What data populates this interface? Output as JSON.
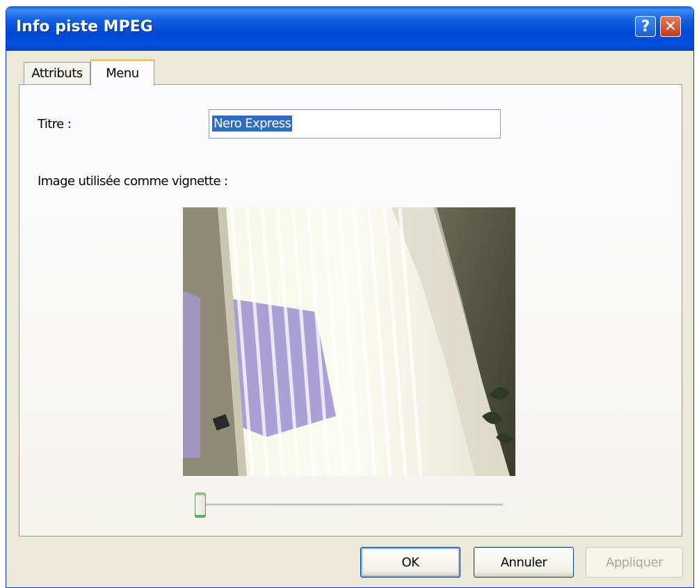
{
  "window": {
    "title": "Info piste MPEG"
  },
  "titlebar": {
    "help_glyph": "?",
    "close_glyph": "✕"
  },
  "tabs": [
    {
      "label": "Attributs",
      "active": false
    },
    {
      "label": "Menu",
      "active": true
    }
  ],
  "menu_tab": {
    "title_label": "Titre :",
    "title_value": "Nero Express",
    "thumbnail_label": "Image utilisée comme vignette :",
    "thumbnail_image": "video-frame-thumbnail",
    "slider_position": 0
  },
  "buttons": {
    "ok": "OK",
    "cancel": "Annuler",
    "apply": "Appliquer",
    "apply_enabled": false
  }
}
